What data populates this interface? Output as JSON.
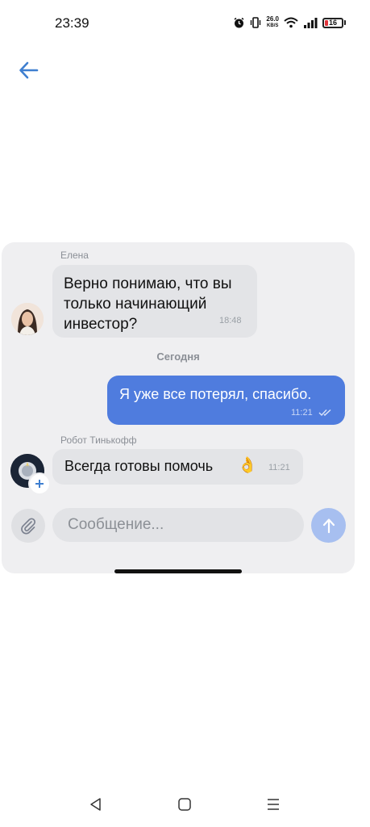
{
  "status_bar": {
    "time": "23:39",
    "net_speed_value": "26.0",
    "net_speed_unit": "KB/S",
    "battery_level": "16"
  },
  "chat": {
    "messages": [
      {
        "sender": "Елена",
        "text_lines": [
          "Верно понимаю, что вы",
          "только начинающий",
          "инвестор?"
        ],
        "time": "18:48",
        "direction": "incoming"
      },
      {
        "text": "Я уже все потерял, спасибо.",
        "time": "11:21",
        "direction": "outgoing",
        "status": "read"
      },
      {
        "sender": "Робот Тинькофф",
        "text": "Всегда готовы помочь",
        "emoji": "👌",
        "time": "11:21",
        "direction": "incoming"
      }
    ],
    "date_separator": "Сегодня"
  },
  "composer": {
    "placeholder": "Сообщение..."
  },
  "colors": {
    "outgoing_bubble": "#4f7cde",
    "incoming_bubble": "#e3e4e7",
    "accent": "#3f7fd0",
    "send_button": "#a7bff0"
  },
  "icons": {
    "back": "arrow-left-icon",
    "attach": "paperclip-icon",
    "send": "arrow-up-icon",
    "read": "double-check-icon"
  }
}
